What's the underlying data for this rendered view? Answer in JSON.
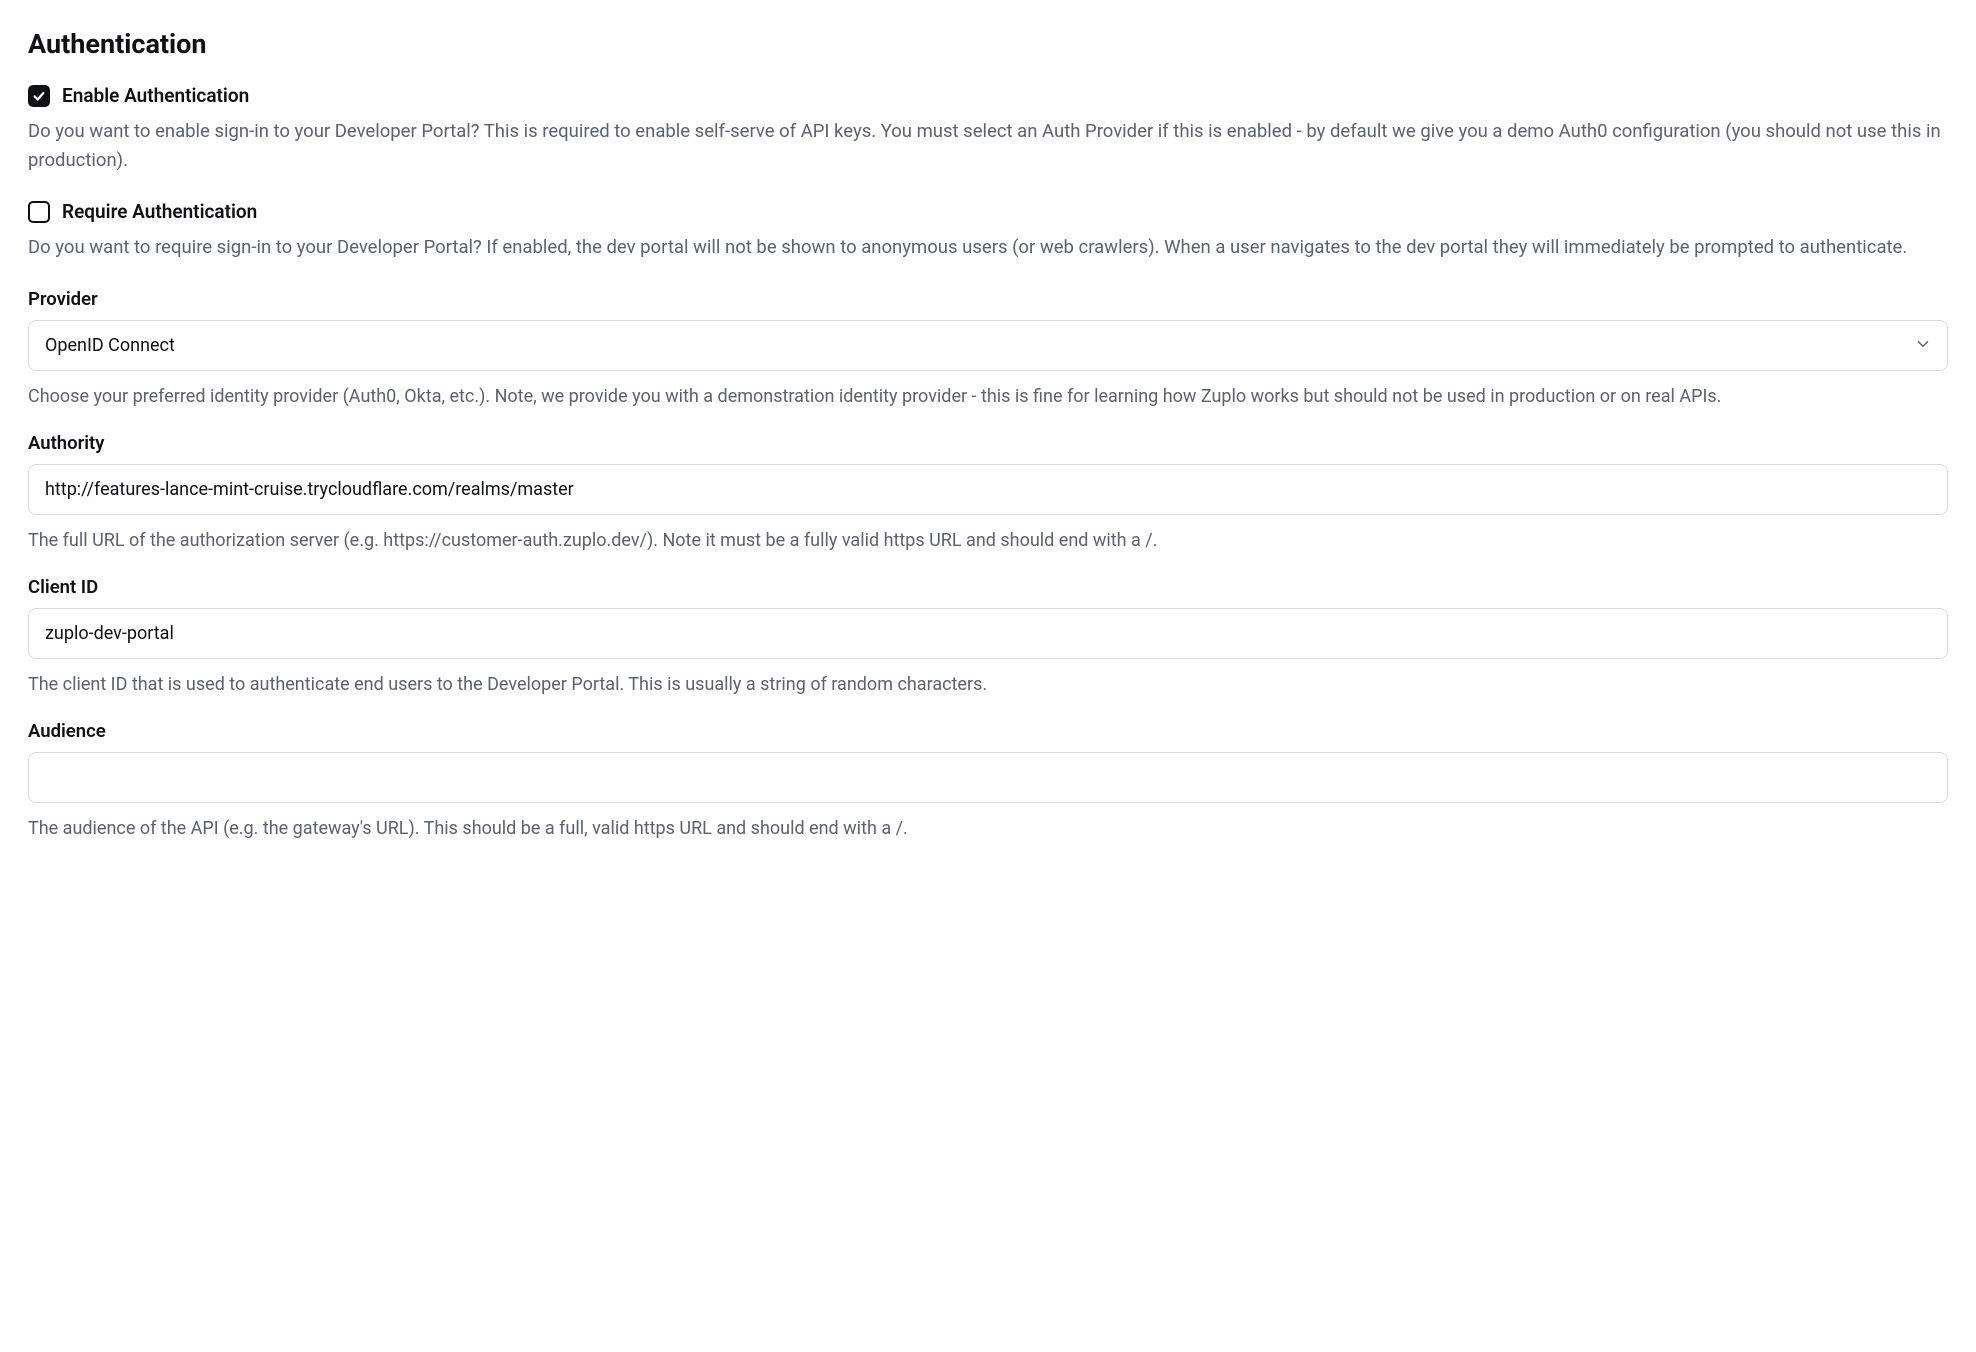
{
  "title": "Authentication",
  "enable_auth": {
    "label": "Enable Authentication",
    "checked": true,
    "description": "Do you want to enable sign-in to your Developer Portal? This is required to enable self-serve of API keys. You must select an Auth Provider if this is enabled - by default we give you a demo Auth0 configuration (you should not use this in production)."
  },
  "require_auth": {
    "label": "Require Authentication",
    "checked": false,
    "description": "Do you want to require sign-in to your Developer Portal? If enabled, the dev portal will not be shown to anonymous users (or web crawlers). When a user navigates to the dev portal they will immediately be prompted to authenticate."
  },
  "provider": {
    "label": "Provider",
    "value": "OpenID Connect",
    "help": "Choose your preferred identity provider (Auth0, Okta, etc.). Note, we provide you with a demonstration identity provider - this is fine for learning how Zuplo works but should not be used in production or on real APIs."
  },
  "authority": {
    "label": "Authority",
    "value": "http://features-lance-mint-cruise.trycloudflare.com/realms/master",
    "help": "The full URL of the authorization server (e.g. https://customer-auth.zuplo.dev/). Note it must be a fully valid https URL and should end with a /."
  },
  "client_id": {
    "label": "Client ID",
    "value": "zuplo-dev-portal",
    "help": "The client ID that is used to authenticate end users to the Developer Portal. This is usually a string of random characters."
  },
  "audience": {
    "label": "Audience",
    "value": "",
    "help": "The audience of the API (e.g. the gateway's URL). This should be a full, valid https URL and should end with a /."
  }
}
